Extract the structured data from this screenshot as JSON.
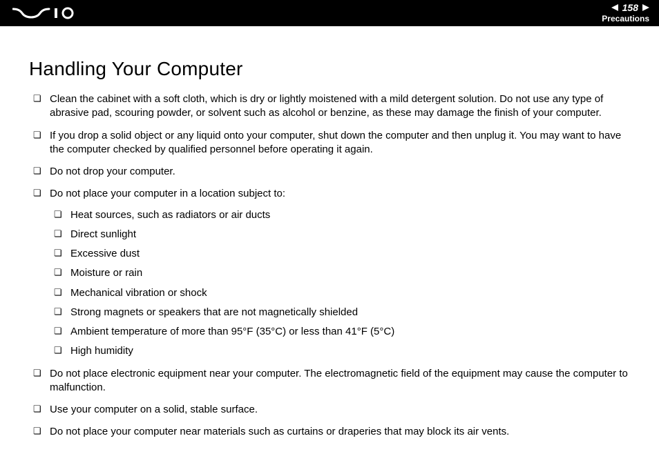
{
  "header": {
    "page_number": "158",
    "section": "Precautions"
  },
  "title": "Handling Your Computer",
  "bullets": [
    "Clean the cabinet with a soft cloth, which is dry or lightly moistened with a mild detergent solution. Do not use any type of abrasive pad, scouring powder, or solvent such as alcohol or benzine, as these may damage the finish of your computer.",
    "If you drop a solid object or any liquid onto your computer, shut down the computer and then unplug it. You may want to have the computer checked by qualified personnel before operating it again.",
    "Do not drop your computer.",
    "Do not place your computer in a location subject to:",
    "Do not place electronic equipment near your computer. The electromagnetic field of the equipment may cause the computer to malfunction.",
    "Use your computer on a solid, stable surface.",
    "Do not place your computer near materials such as curtains or draperies that may block its air vents."
  ],
  "sub_bullets": [
    "Heat sources, such as radiators or air ducts",
    "Direct sunlight",
    "Excessive dust",
    "Moisture or rain",
    "Mechanical vibration or shock",
    "Strong magnets or speakers that are not magnetically shielded",
    "Ambient temperature of more than 95°F (35°C) or less than 41°F (5°C)",
    "High humidity"
  ]
}
